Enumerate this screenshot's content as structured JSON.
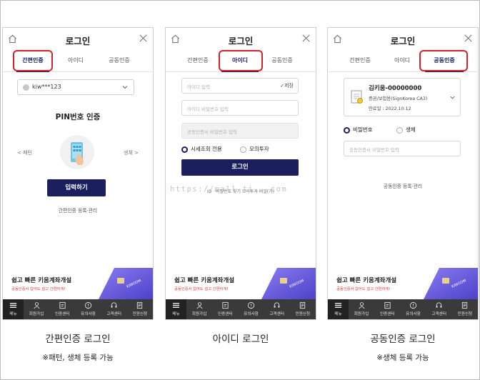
{
  "screens": [
    {
      "header_title": "로그인",
      "tabs": [
        "간편인증",
        "아이디",
        "공동인증"
      ],
      "active_tab": 0,
      "account_value": "kiw***123",
      "pin_title": "PIN번호 인증",
      "pattern_label": "< 패턴",
      "bio_label": "생체 >",
      "input_button": "입력하기",
      "manage_link": "간편인증 등록·관리",
      "banner_title": "쉽고 빠른 키움계좌개설",
      "banner_sub": "공동인증서 없어도 쉽고 간편하게!"
    },
    {
      "header_title": "로그인",
      "tabs": [
        "간편인증",
        "아이디",
        "공동인증"
      ],
      "active_tab": 1,
      "id_placeholder": "아이디 입력",
      "save_label": "✓저장",
      "pw_placeholder": "아이디 비밀번호 입력",
      "cert_pw_placeholder": "공동인증서 비밀번호 입력",
      "radio_quote": "시세조회 전용",
      "radio_mock": "모의투자",
      "login_button": "로그인",
      "links": "ID · 비밀번호 찾기   모의투자 비밀(가)",
      "banner_title": "쉽고 빠른 키움계좌개설",
      "banner_sub": "공동인증서 없어도 쉽고 간편하게!"
    },
    {
      "header_title": "로그인",
      "tabs": [
        "간편인증",
        "아이디",
        "공동인증"
      ],
      "active_tab": 2,
      "cert_name": "김키움-00000000",
      "cert_issuer": "증권/보험용(SignKorea CA3)",
      "cert_expiry": "만료일 : 2022.10.12",
      "radio_password": "비밀번호",
      "radio_bio": "생체",
      "cert_pw_placeholder": "공동인증서 비밀번호 입력",
      "manage_link": "공동인증 등록·관리",
      "banner_title": "쉽고 빠른 키움계좌개설",
      "banner_sub": "공동인증서 없어도 쉽고 간편하게!"
    }
  ],
  "bottom_nav": [
    "메뉴",
    "회원가입",
    "인증센터",
    "유의사항",
    "고객센터",
    "민원신청"
  ],
  "captions": [
    {
      "main": "간편인증 로그인",
      "note": "※패턴, 생체 등록 가능"
    },
    {
      "main": "아이디 로그인",
      "note": ""
    },
    {
      "main": "공동인증 로그인",
      "note": "※생체 등록 가능"
    }
  ],
  "watermark": "https://mall-ti...com",
  "colors": {
    "accent": "#1b1f5e",
    "highlight": "#d2232a",
    "nav_bg": "#3a3a3a"
  }
}
